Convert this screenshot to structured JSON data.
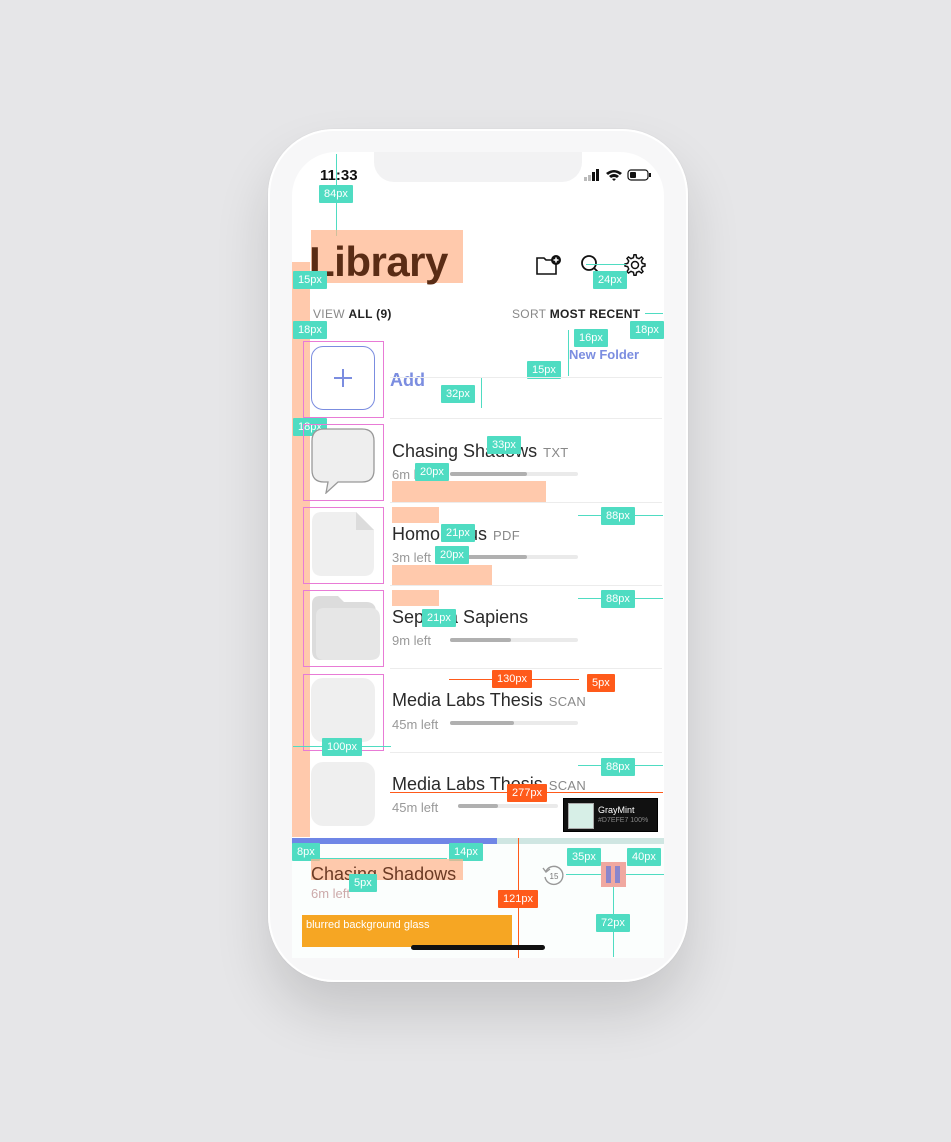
{
  "status_bar": {
    "time": "11:33"
  },
  "header": {
    "title": "Library",
    "icons": [
      "new-folder-icon",
      "search-icon",
      "gear-icon"
    ]
  },
  "filter": {
    "view_label": "VIEW",
    "view_value": "ALL (9)",
    "sort_label": "SORT",
    "sort_value": "MOST RECENT"
  },
  "new_folder_label": "New Folder",
  "add_label": "Add",
  "items": [
    {
      "title": "Chasing Shadows",
      "type": "TXT",
      "left": "6m left",
      "progress": 0.6,
      "thumb": "speech-bubble-icon"
    },
    {
      "title": "Homo Deus",
      "type": "PDF",
      "left": "3m left",
      "progress": 0.6,
      "thumb": "document-icon"
    },
    {
      "title": "Sepiena Sapiens",
      "type": "",
      "left": "9m left",
      "progress": 0.48,
      "thumb": "folder-icon"
    },
    {
      "title": "Media Labs Thesis",
      "type": "SCAN",
      "left": "45m left",
      "progress": 0.5,
      "thumb": ""
    },
    {
      "title": "Media Labs Thesis",
      "type": "SCAN",
      "left": "45m left",
      "progress": 0.4,
      "thumb": ""
    }
  ],
  "player": {
    "title": "Chasing Shadows",
    "left": "6m left",
    "progress": 0.55,
    "rewind_label": "15"
  },
  "annotations": {
    "glass_label": "blurred background glass",
    "swatch_name": "GrayMint",
    "swatch_code": "#D7EFE7 100%",
    "specs": [
      "84px",
      "15px",
      "24px",
      "18px",
      "18px",
      "16px",
      "15px",
      "32px",
      "18px",
      "33px",
      "20px",
      "21px",
      "20px",
      "88px",
      "21px",
      "88px",
      "130px",
      "5px",
      "100px",
      "88px",
      "277px",
      "8px",
      "14px",
      "35px",
      "40px",
      "5px",
      "121px",
      "72px"
    ]
  },
  "colors": {
    "accent": "#7B8DE0",
    "title": "#5A2C15",
    "spec": "#4FDCC2",
    "spec_alt": "#FF5A1A",
    "glass": "#F6A623",
    "graymint": "#D7EFE7"
  }
}
